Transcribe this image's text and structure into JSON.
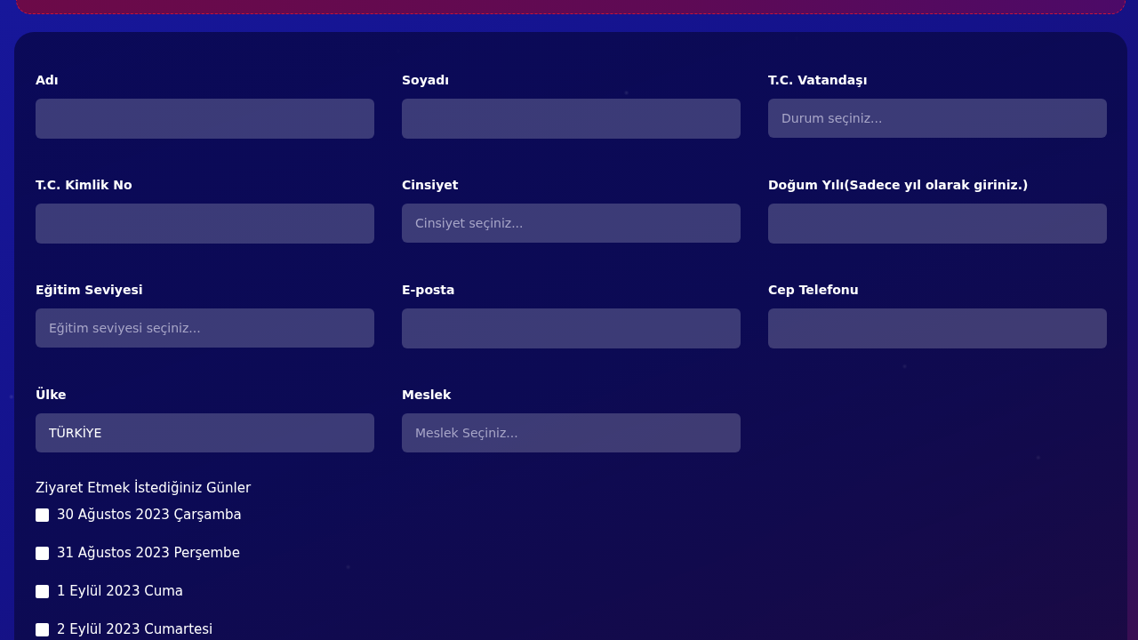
{
  "form": {
    "fields": [
      {
        "label": "Adı",
        "kind": "input"
      },
      {
        "label": "Soyadı",
        "kind": "input"
      },
      {
        "label": "T.C. Vatandaşı",
        "kind": "select",
        "placeholder": "Durum seçiniz..."
      },
      {
        "label": "T.C. Kimlik No",
        "kind": "input"
      },
      {
        "label": "Cinsiyet",
        "kind": "select",
        "placeholder": "Cinsiyet seçiniz..."
      },
      {
        "label": "Doğum Yılı(Sadece yıl olarak giriniz.)",
        "kind": "input"
      },
      {
        "label": "Eğitim Seviyesi",
        "kind": "select",
        "placeholder": "Eğitim seviyesi seçiniz..."
      },
      {
        "label": "E-posta",
        "kind": "input"
      },
      {
        "label": "Cep Telefonu",
        "kind": "input"
      },
      {
        "label": "Ülke",
        "kind": "select",
        "value": "TÜRKİYE"
      },
      {
        "label": "Meslek",
        "kind": "select",
        "placeholder": "Meslek Seçiniz..."
      }
    ],
    "visit_days": {
      "title": "Ziyaret Etmek İstediğiniz Günler",
      "options": [
        {
          "label": "30 Ağustos 2023 Çarşamba",
          "checked": false
        },
        {
          "label": "31 Ağustos 2023 Perşembe",
          "checked": false
        },
        {
          "label": "1 Eylül 2023 Cuma",
          "checked": false
        },
        {
          "label": "2 Eylül 2023 Cumartesi",
          "checked": false
        }
      ]
    }
  }
}
